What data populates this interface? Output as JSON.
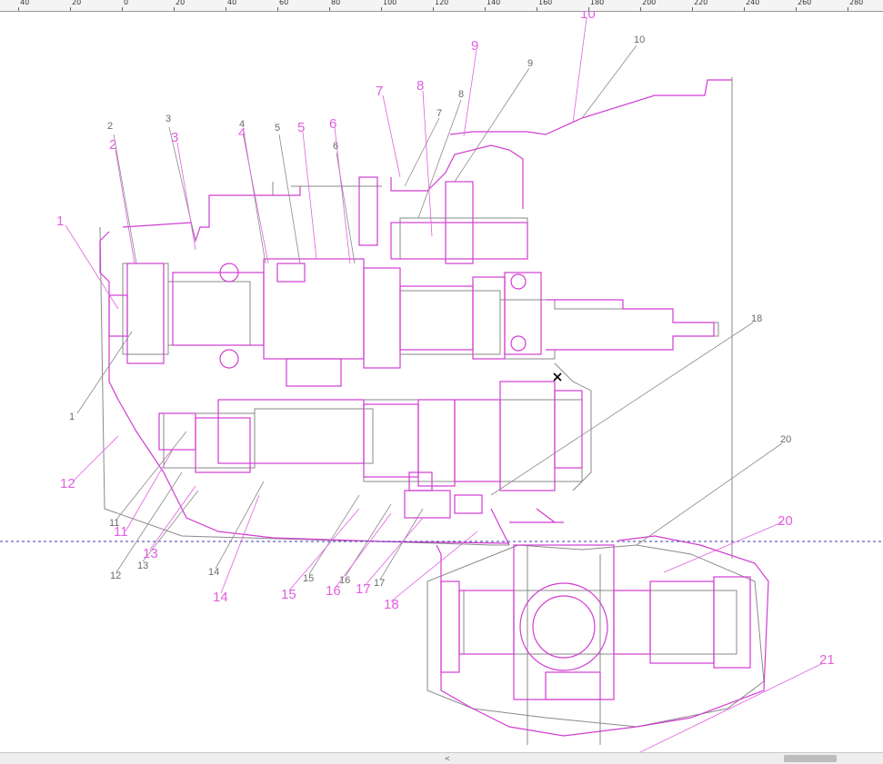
{
  "ruler": {
    "labels": [
      "40",
      "20",
      "0",
      "20",
      "40",
      "60",
      "80",
      "100",
      "120",
      "140",
      "160",
      "180",
      "200",
      "220",
      "240",
      "260",
      "280"
    ]
  },
  "colors": {
    "overlay": "#d23cd2",
    "base": "#8a8a8a",
    "guide": "#3b3bb0",
    "label_gray": "#6b6b6b",
    "label_magenta": "#e060e0"
  },
  "labels_gray": [
    "1",
    "2",
    "3",
    "4",
    "5",
    "6",
    "7",
    "8",
    "9",
    "10",
    "11",
    "12",
    "13",
    "14",
    "15",
    "16",
    "17",
    "18",
    "20"
  ],
  "labels_magenta": [
    "1",
    "2",
    "3",
    "4",
    "5",
    "6",
    "7",
    "8",
    "9",
    "10",
    "11",
    "12",
    "13",
    "14",
    "15",
    "16",
    "17",
    "18",
    "20",
    "21"
  ],
  "cursor": "crosshair-marker",
  "scrollbar": {
    "left_arrow": "<"
  }
}
